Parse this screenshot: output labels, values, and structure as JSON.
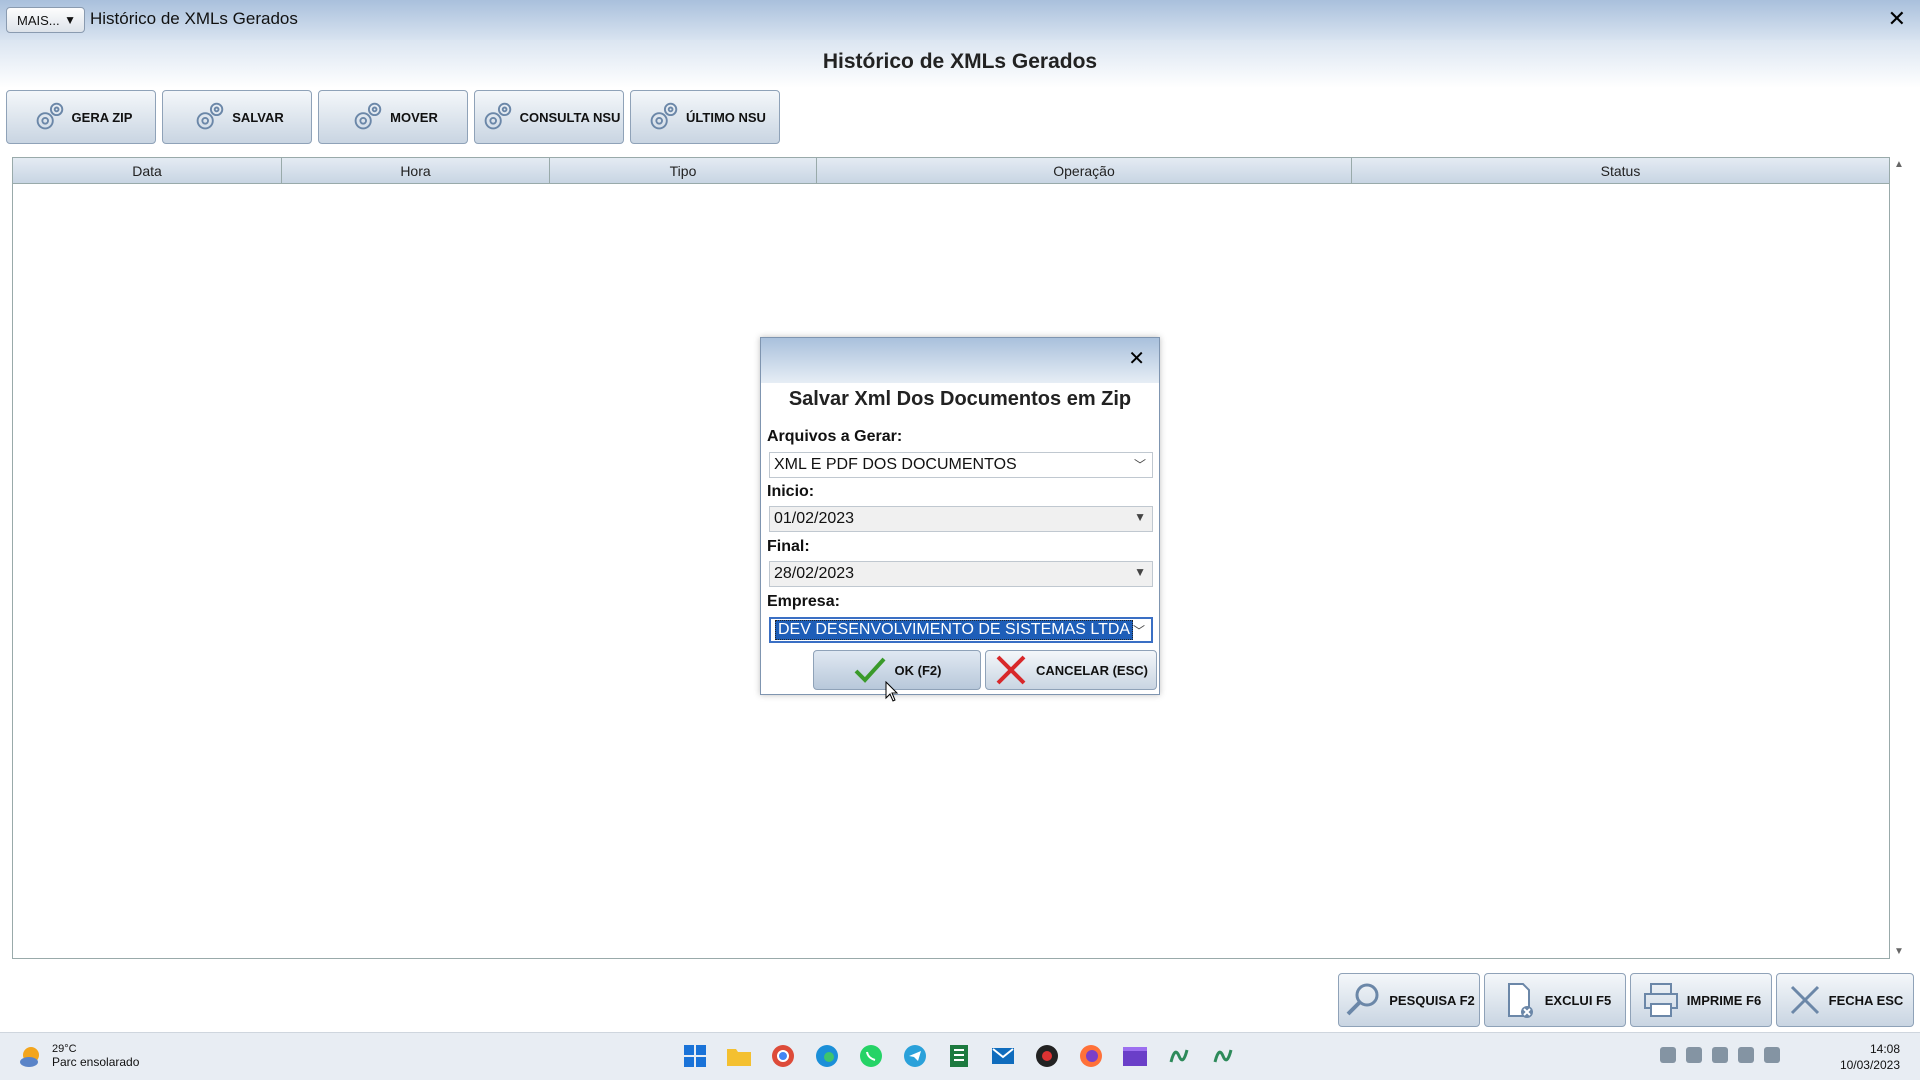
{
  "window": {
    "more_label": "MAIS...",
    "title": "Histórico de XMLs Gerados",
    "close_glyph": "✕"
  },
  "page_title": "Histórico de XMLs Gerados",
  "toolbar": [
    {
      "label": "GERA ZIP",
      "icon": "gear-icon"
    },
    {
      "label": "SALVAR",
      "icon": "gear-icon"
    },
    {
      "label": "MOVER",
      "icon": "gear-icon"
    },
    {
      "label": "CONSULTA NSU",
      "icon": "gear-icon"
    },
    {
      "label": "ÚLTIMO NSU",
      "icon": "gear-icon"
    }
  ],
  "grid": {
    "columns": [
      "Data",
      "Hora",
      "Tipo",
      "Operação",
      "Status"
    ],
    "rows": []
  },
  "dialog": {
    "title": "Salvar Xml Dos Documentos em Zip",
    "close_glyph": "✕",
    "files_label": "Arquivos a Gerar:",
    "files_value": "XML E PDF DOS DOCUMENTOS",
    "start_label": "Inicio:",
    "start_value": "01/02/2023",
    "end_label": "Final:",
    "end_value": "28/02/2023",
    "company_label": "Empresa:",
    "company_value": "DEV DESENVOLVIMENTO DE SISTEMAS LTDA",
    "ok_label": "OK (F2)",
    "cancel_label": "CANCELAR (ESC)"
  },
  "bottom_buttons": [
    {
      "label": "PESQUISA F2",
      "icon": "magnifier-icon"
    },
    {
      "label": "EXCLUI F5",
      "icon": "delete-document-icon"
    },
    {
      "label": "IMPRIME F6",
      "icon": "printer-icon"
    },
    {
      "label": "FECHA ESC",
      "icon": "close-x-icon"
    }
  ],
  "taskbar": {
    "temperature": "29°C",
    "weather": "Parc ensolarado",
    "time": "14:08",
    "date": "10/03/2023",
    "apps": [
      "windows-start-icon",
      "file-explorer-icon",
      "chrome-icon",
      "edge-icon",
      "whatsapp-icon",
      "telegram-icon",
      "spreadsheet-app-icon",
      "outlook-icon",
      "app-icon",
      "firefox-icon",
      "clapper-icon",
      "erp-app-icon",
      "erp-app-icon"
    ]
  },
  "colors": {
    "accent": "#1e5eb8",
    "title_bar": "#a9c0dc"
  }
}
